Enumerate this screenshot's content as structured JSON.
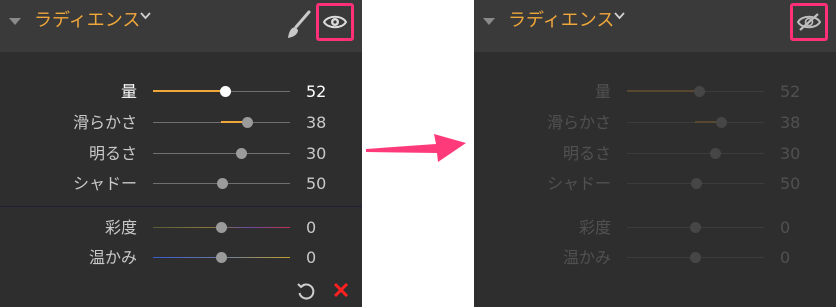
{
  "panel_title": "ラディエンス",
  "sliders": [
    {
      "label": "量",
      "value": "52",
      "fraction": 0.52,
      "fill": "left"
    },
    {
      "label": "滑らかさ",
      "value": "38",
      "fraction": 0.69,
      "fill": "partial"
    },
    {
      "label": "明るさ",
      "value": "30",
      "fraction": 0.65,
      "fill": "none"
    },
    {
      "label": "シャドー",
      "value": "50",
      "fraction": 0.5,
      "fill": "none"
    }
  ],
  "color_sliders": [
    {
      "label": "彩度",
      "value": "0",
      "fraction": 0.5
    },
    {
      "label": "温かみ",
      "value": "0",
      "fraction": 0.5
    }
  ],
  "colors": {
    "accent": "#f0a73a",
    "highlight_box": "#ff2f78",
    "panel_bg": "#2e2e2e",
    "header_bg": "#3a3a3a",
    "reset_x": "#ff2020"
  },
  "icons": {
    "visible": "eye-icon",
    "hidden": "eye-slash-icon",
    "brush": "brush-icon",
    "reset": "undo-icon",
    "delete": "close-icon",
    "arrow": "arrow-right-icon"
  }
}
